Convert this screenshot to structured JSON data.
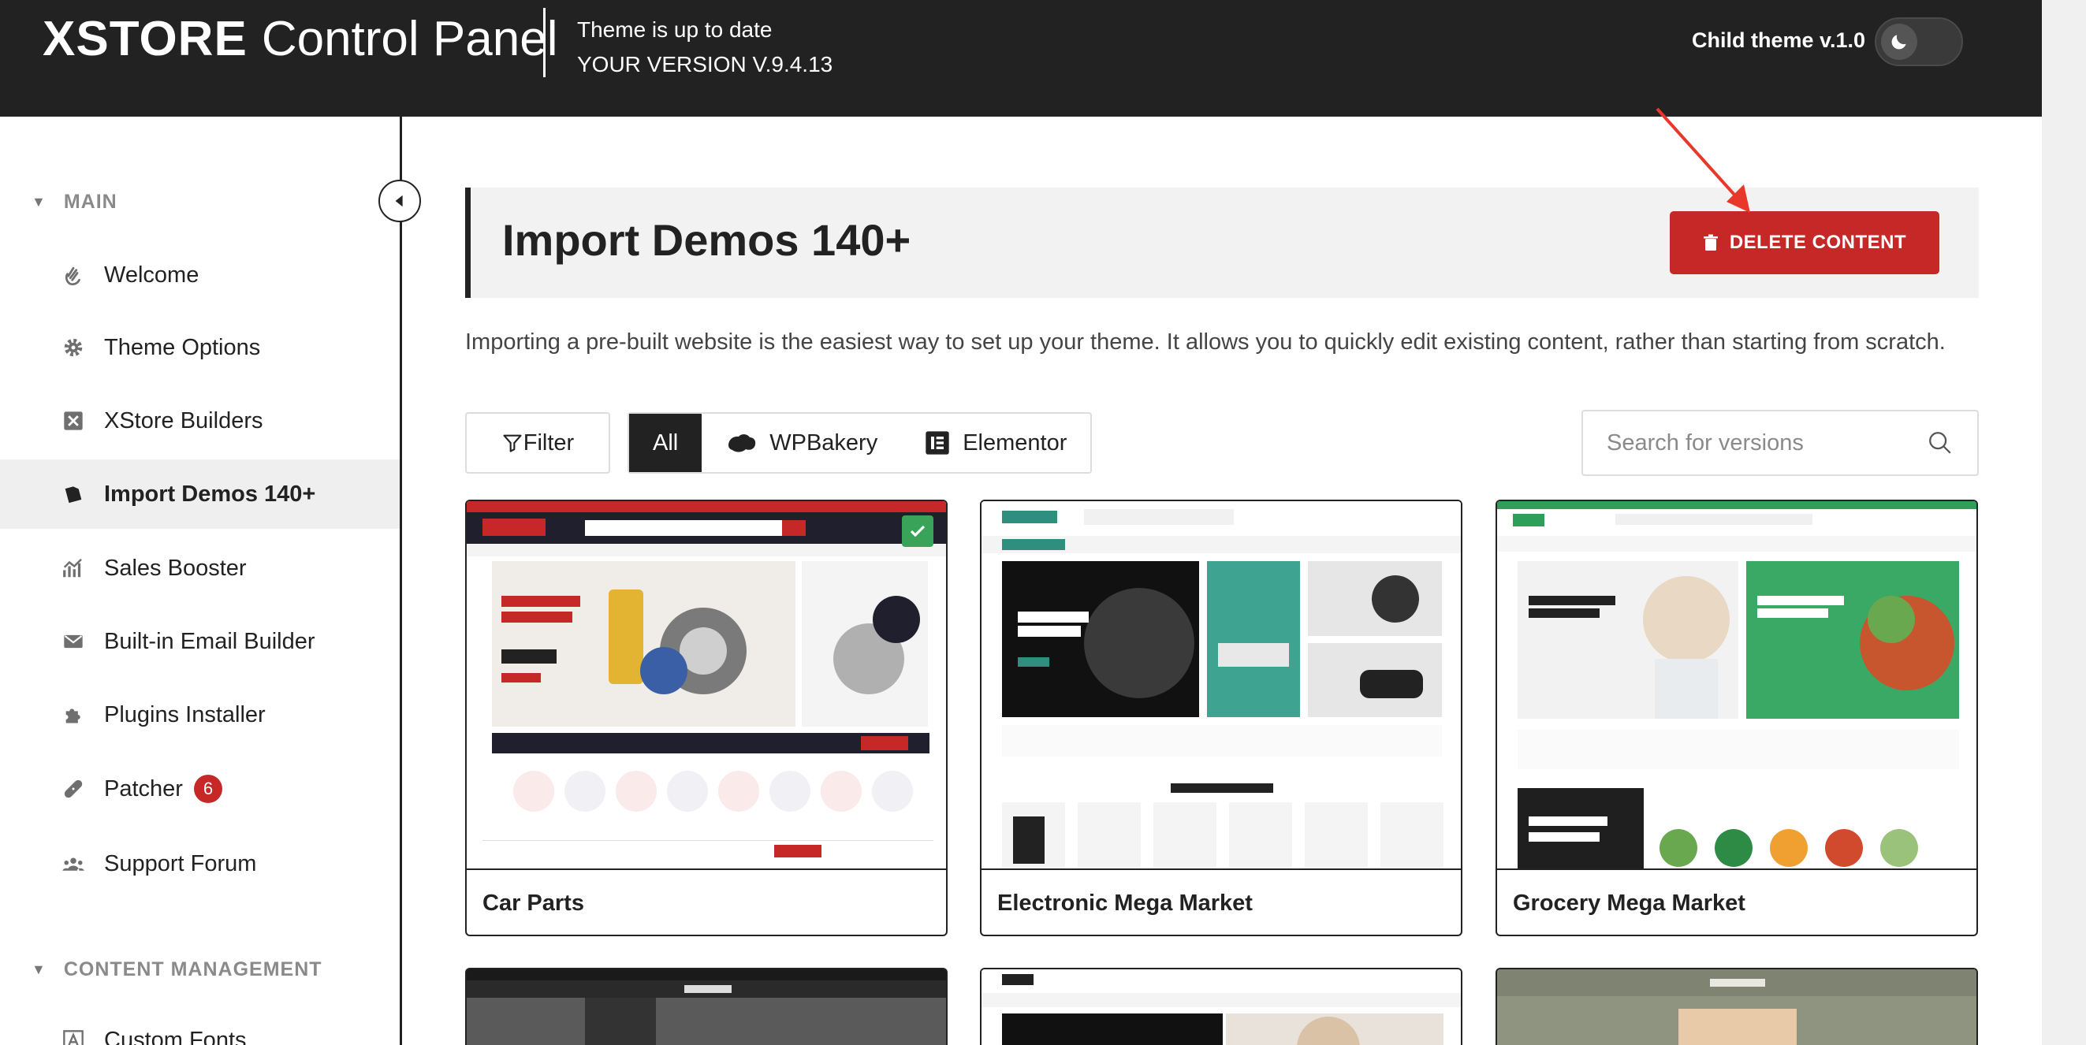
{
  "header": {
    "brand": "XSTORE",
    "product": "Control Panel",
    "status_line": "Theme is up to date",
    "version_line": "YOUR VERSION V.9.4.13",
    "child_theme": "Child theme v.1.0",
    "dark_mode_toggle_icon": "moon-icon"
  },
  "sidebar": {
    "main_section": "MAIN",
    "items": [
      {
        "label": "Welcome",
        "icon": "wave-hand-icon"
      },
      {
        "label": "Theme Options",
        "icon": "gear-icon"
      },
      {
        "label": "XStore Builders",
        "icon": "builder-icon"
      },
      {
        "label": "Import Demos 140+",
        "icon": "import-icon",
        "active": true
      },
      {
        "label": "Sales Booster",
        "icon": "chart-icon"
      },
      {
        "label": "Built-in Email Builder",
        "icon": "envelope-icon"
      },
      {
        "label": "Plugins Installer",
        "icon": "puzzle-icon"
      },
      {
        "label": "Patcher",
        "icon": "bandage-icon",
        "badge": "6"
      },
      {
        "label": "Support Forum",
        "icon": "users-icon"
      }
    ],
    "content_section": "CONTENT MANAGEMENT",
    "content_items": [
      {
        "label": "Custom Fonts",
        "icon": "font-icon"
      }
    ]
  },
  "main": {
    "title": "Import Demos 140+",
    "delete_button": "DELETE CONTENT",
    "intro": "Importing a pre-built website is the easiest way to set up your theme. It allows you to quickly edit existing content, rather than starting from scratch.",
    "filter_button": "Filter",
    "builder_tabs": [
      "All",
      "WPBakery",
      "Elementor"
    ],
    "search_placeholder": "Search for versions",
    "demos": [
      {
        "name": "Car Parts",
        "imported": true
      },
      {
        "name": "Electronic Mega Market"
      },
      {
        "name": "Grocery Mega Market"
      }
    ],
    "colors": {
      "accent": "#c62828",
      "dark": "#222222",
      "active_bg": "#efefef"
    }
  }
}
